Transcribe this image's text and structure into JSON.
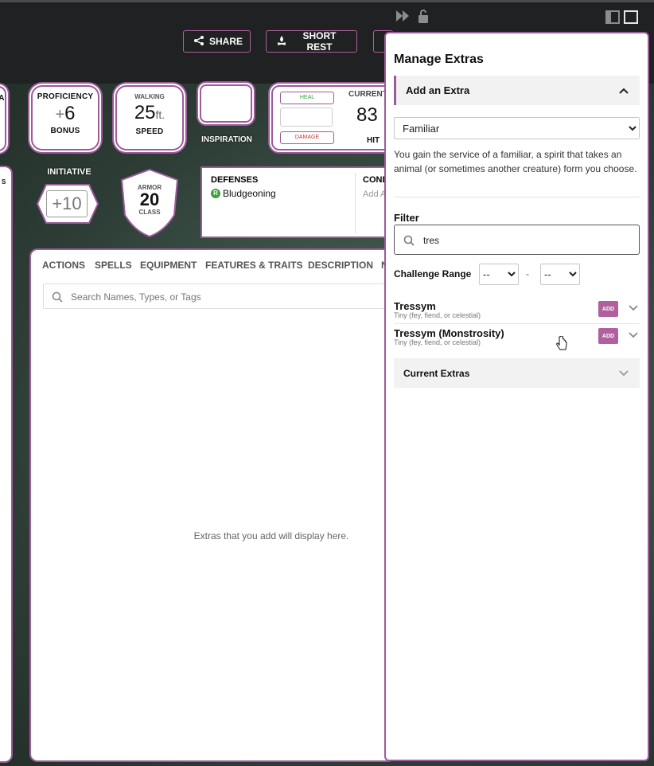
{
  "header": {
    "share_label": "SHARE",
    "short_rest_label": "SHORT REST"
  },
  "stats": {
    "proficiency": {
      "label": "PROFICIENCY",
      "sign": "+",
      "value": "6",
      "sublabel": "BONUS"
    },
    "speed": {
      "top_label": "WALKING",
      "value": "25",
      "unit": "ft.",
      "sublabel": "SPEED"
    },
    "inspiration_label": "INSPIRATION",
    "hp": {
      "heal_label": "HEAL",
      "damage_label": "DAMAGE",
      "current_label": "CURRENT",
      "current_value": "83",
      "hit_label": "HIT"
    },
    "initiative": {
      "label": "INITIATIVE",
      "value": "+10"
    },
    "armor": {
      "top": "ARMOR",
      "value": "20",
      "bottom": "CLASS"
    },
    "defenses": {
      "title": "DEFENSES",
      "badge": "R",
      "item": "Bludgeoning"
    },
    "conditions": {
      "title": "COND",
      "add": "Add A"
    }
  },
  "left_edge": {
    "label": "A",
    "label2": "S"
  },
  "tabs": [
    "ACTIONS",
    "SPELLS",
    "EQUIPMENT",
    "FEATURES & TRAITS",
    "DESCRIPTION",
    "N"
  ],
  "search": {
    "placeholder": "Search Names, Types, or Tags"
  },
  "main_empty_text": "Extras that you add will display here.",
  "sidebar": {
    "title": "Manage Extras",
    "add_section": "Add an Extra",
    "type_select": {
      "selected": "Familiar"
    },
    "description": "You gain the service of a familiar, a spirit that takes an animal (or sometimes another creature) form you choose.",
    "filter_label": "Filter",
    "filter_value": "tres",
    "challenge_label": "Challenge Range",
    "cr_min": "--",
    "cr_max": "--",
    "range_sep": "-",
    "results": [
      {
        "name": "Tressym",
        "meta": "Tiny (fey, fiend, or celestial)",
        "add_label": "ADD"
      },
      {
        "name": "Tressym (Monstrosity)",
        "meta": "Tiny (fey, fiend, or celestial)",
        "add_label": "ADD"
      }
    ],
    "current_section": "Current Extras"
  },
  "colors": {
    "accent": "#9d5b99",
    "button": "#b0619d",
    "heal": "#3aa23a",
    "damage": "#c23b3b",
    "badge": "#3aa23a"
  },
  "icons": [
    "share-icon",
    "campfire-icon",
    "fast-forward-icon",
    "unlock-icon",
    "sidebar-left-icon",
    "sidebar-full-icon",
    "search-icon",
    "chevron-up-icon",
    "chevron-down-icon",
    "cursor-hand-icon"
  ]
}
